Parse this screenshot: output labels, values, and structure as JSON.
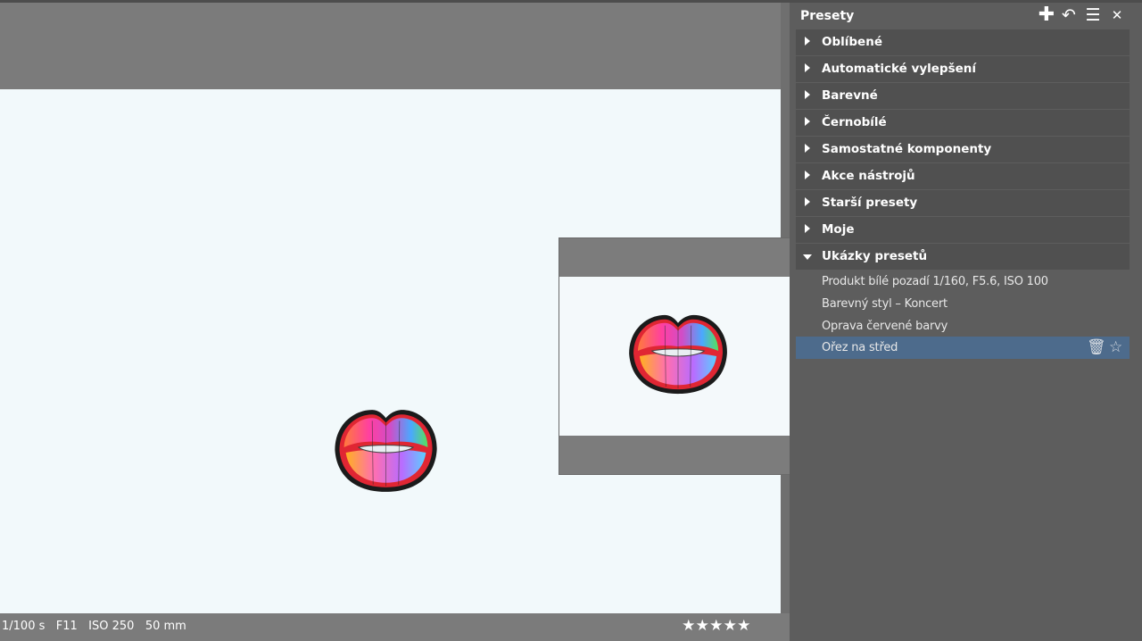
{
  "viewer": {
    "status": {
      "exif": "1/100 s   F11   ISO 250   50 mm",
      "rating_stars": [
        "★",
        "★",
        "★",
        "★",
        "★"
      ],
      "rating_value": 5
    }
  },
  "panel": {
    "title": "Presety",
    "icons": {
      "add": "✚",
      "undo": "↶",
      "menu": "☰",
      "close": "✕"
    },
    "categories": [
      {
        "label": "Oblíbené",
        "expanded": false
      },
      {
        "label": "Automatické vylepšení",
        "expanded": false
      },
      {
        "label": "Barevné",
        "expanded": false
      },
      {
        "label": "Černobílé",
        "expanded": false
      },
      {
        "label": "Samostatné komponenty",
        "expanded": false
      },
      {
        "label": "Akce nástrojů",
        "expanded": false
      },
      {
        "label": "Starší presety",
        "expanded": false
      },
      {
        "label": "Moje",
        "expanded": false
      },
      {
        "label": "Ukázky presetů",
        "expanded": true
      }
    ],
    "presets": [
      {
        "label": "Produkt bílé pozadí 1/160, F5.6, ISO 100"
      },
      {
        "label": "Barevný styl – Koncert"
      },
      {
        "label": "Oprava červené barvy"
      },
      {
        "label": "Ořez na střed",
        "selected": true
      }
    ],
    "preset_actions": {
      "delete": "🗑",
      "favorite": "☆"
    }
  },
  "colors": {
    "panel_bg": "#5d5d5d",
    "category_bg": "#505050",
    "selected_bg": "#4d6b8c",
    "photo_bg": "#f2f9fb"
  }
}
